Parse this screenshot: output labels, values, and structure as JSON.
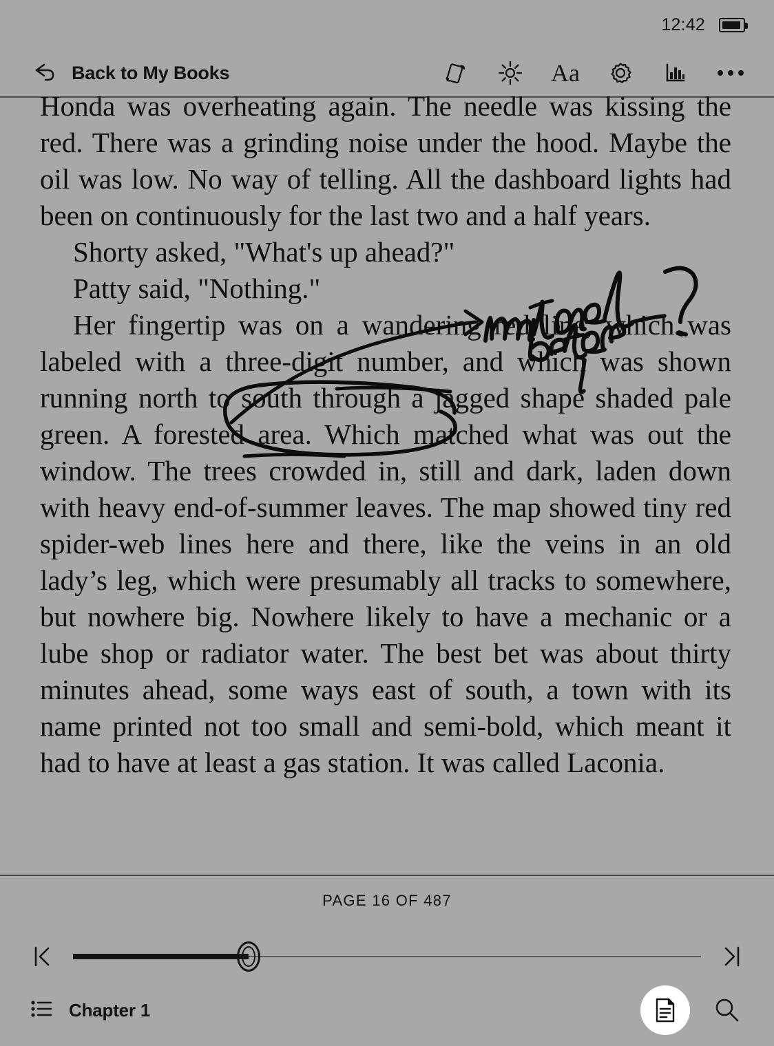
{
  "status": {
    "time": "12:42",
    "battery_icon": "battery-icon",
    "battery_level_pct": 85
  },
  "header": {
    "back_label": "Back to My Books",
    "back_icon": "back-arrow-icon",
    "tools": [
      {
        "name": "rotation-lock-icon",
        "label": "Rotation"
      },
      {
        "name": "brightness-icon",
        "label": "Brightness"
      },
      {
        "name": "font-size-icon",
        "label": "Aa"
      },
      {
        "name": "settings-gear-icon",
        "label": "Settings"
      },
      {
        "name": "reading-stats-icon",
        "label": "Stats"
      },
      {
        "name": "more-options-icon",
        "label": "More"
      }
    ]
  },
  "content": {
    "paragraphs": [
      {
        "style": "cont",
        "text": "Honda was overheating again. The needle was kissing the red. There was a grinding noise under the hood. Maybe the oil was low. No way of telling. All the dashboard lights had been on continuously for the last two and a half years."
      },
      {
        "style": "indent",
        "text": "Shorty asked, \"What's up ahead?\""
      },
      {
        "style": "indent",
        "text": "Patty said, \"Nothing.\""
      },
      {
        "style": "indent",
        "text": "Her fingertip was on a wandering red line, which was labeled with a three-digit number, and which was shown running north to south through a jagged shape shaded pale green. A forested area. Which matched what was out the window. The trees crowded in, still and dark, laden down with heavy end-of-summer leaves. The map showed tiny red spider-web lines here and there, like the veins in an old lady’s leg, which were presumably all tracks to somewhere, but nowhere big. Nowhere likely to have a mechanic or a lube shop or radiator water. The best bet was about thirty minutes ahead, some ways east of south, a town with its name printed not too small and semi-bold, which meant it had to have at least a gas station. It was called Laconia."
      }
    ]
  },
  "annotations": {
    "ink_color": "#0d0d0d",
    "handwritten_note": "mentioned before ?",
    "marks": [
      {
        "type": "strikethrough",
        "target": "a wandering"
      },
      {
        "type": "circle",
        "target": "three-digit number,"
      },
      {
        "type": "strikethrough",
        "target": "to south"
      },
      {
        "type": "arrow",
        "target": "points from circled text to note"
      },
      {
        "type": "question-mark",
        "target": "note emphasis"
      }
    ]
  },
  "footer": {
    "page_indicator": "PAGE 16 OF 487",
    "current_page": 16,
    "total_pages": 487,
    "progress_pct": 28,
    "first_page_icon": "skip-to-start-icon",
    "last_page_icon": "skip-to-end-icon",
    "chapter_label": "Chapter 1",
    "chapter_icon": "table-of-contents-icon",
    "notes_icon": "notes-document-icon",
    "search_icon": "search-icon"
  }
}
